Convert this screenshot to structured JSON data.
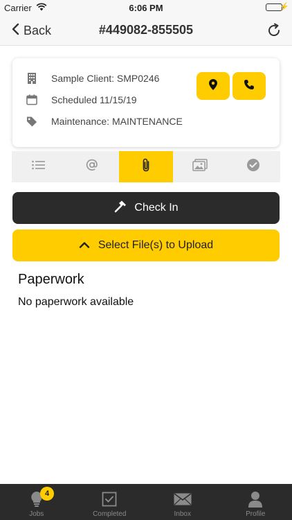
{
  "status_bar": {
    "carrier": "Carrier",
    "time": "6:06 PM"
  },
  "nav": {
    "back_label": "Back",
    "title": "#449082-855505"
  },
  "job": {
    "client": "Sample Client: SMP0246",
    "scheduled": "Scheduled 11/15/19",
    "type": "Maintenance: MAINTENANCE"
  },
  "tabs": [
    {
      "icon": "list-icon",
      "active": false
    },
    {
      "icon": "at-icon",
      "active": false
    },
    {
      "icon": "paperclip-icon",
      "active": true
    },
    {
      "icon": "photos-icon",
      "active": false
    },
    {
      "icon": "check-circle-icon",
      "active": false
    }
  ],
  "actions": {
    "check_in_label": "Check In",
    "upload_label": "Select File(s) to Upload"
  },
  "paperwork": {
    "title": "Paperwork",
    "empty_text": "No paperwork available"
  },
  "bottom_tabs": {
    "jobs": {
      "label": "Jobs",
      "badge": "4"
    },
    "completed": {
      "label": "Completed"
    },
    "inbox": {
      "label": "Inbox"
    },
    "profile": {
      "label": "Profile"
    }
  },
  "colors": {
    "accent": "#ffcc00",
    "dark": "#2b2b2b",
    "battery": "#4cd964"
  }
}
